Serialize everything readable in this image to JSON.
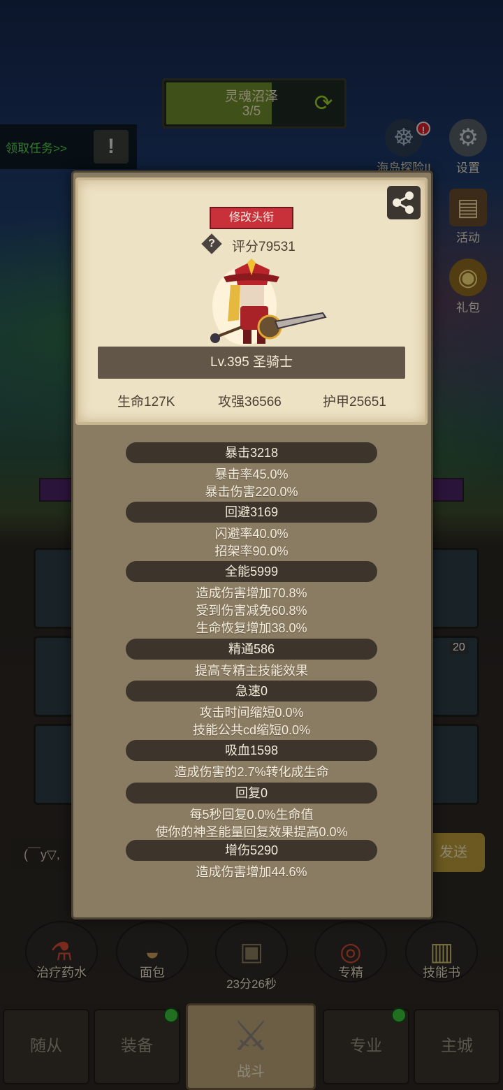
{
  "zone": {
    "name": "灵魂沼泽",
    "progress": "3/5",
    "progress_fraction": 0.6
  },
  "quest": {
    "label": "领取任务>>",
    "icon": "exclamation-icon"
  },
  "side_icons": {
    "island": {
      "label": "海岛探险II",
      "icon": "island-icon"
    },
    "settings": {
      "label": "设置",
      "icon": "gear-icon"
    },
    "activity": {
      "label": "活动",
      "icon": "scroll-icon"
    },
    "gift": {
      "label": "礼包",
      "icon": "gift-icon"
    }
  },
  "equipment_slot_badge": "20",
  "chat": {
    "input_text": "(￣y▽,",
    "send_label": "发送"
  },
  "actions": {
    "potion": "治疗药水",
    "bread": "面包",
    "chest_timer": "23分26秒",
    "specialization": "专精",
    "skill_book": "技能书"
  },
  "nav": {
    "followers": "随从",
    "equipment": "装备",
    "battle": "战斗",
    "profession": "专业",
    "main_city": "主城"
  },
  "profile": {
    "edit_title_button": "修改头衔",
    "score": "评分79531",
    "name_plate": "Lv.395 圣骑士",
    "hp": "生命127K",
    "attack": "攻强36566",
    "armor": "护甲25651"
  },
  "stats": [
    {
      "header": "暴击3218",
      "lines": [
        "暴击率45.0%",
        "暴击伤害220.0%"
      ]
    },
    {
      "header": "回避3169",
      "lines": [
        "闪避率40.0%",
        "招架率90.0%"
      ]
    },
    {
      "header": "全能5999",
      "lines": [
        "造成伤害增加70.8%",
        "受到伤害减免60.8%",
        "生命恢复增加38.0%"
      ]
    },
    {
      "header": "精通586",
      "lines": [
        "提高专精主技能效果"
      ]
    },
    {
      "header": "急速0",
      "lines": [
        "攻击时间缩短0.0%",
        "技能公共cd缩短0.0%"
      ]
    },
    {
      "header": "吸血1598",
      "lines": [
        "造成伤害的2.7%转化成生命"
      ]
    },
    {
      "header": "回复0",
      "lines": [
        "每5秒回复0.0%生命值",
        "使你的神圣能量回复效果提高0.0%"
      ]
    },
    {
      "header": "增伤5290",
      "lines": [
        "造成伤害增加44.6%"
      ]
    }
  ],
  "colors": {
    "panel": "#8a7b63",
    "paper": "#ede2c4",
    "pill": "#3d342c",
    "title_button": "#c8303a",
    "quest_text": "#54d24a"
  }
}
